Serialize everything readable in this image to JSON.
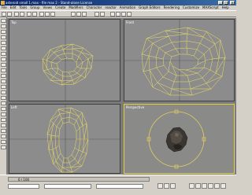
{
  "window": {
    "title": "asteroid small 1.max - file max 2 - Stand-alone License"
  },
  "menu": [
    "File",
    "Edit",
    "Tools",
    "Group",
    "Views",
    "Create",
    "Modifiers",
    "Character",
    "reactor",
    "Animation",
    "Graph Editors",
    "Rendering",
    "Customize",
    "MAXScript",
    "Help"
  ],
  "viewports": {
    "top": "Top",
    "front": "Front",
    "left": "Left",
    "perspective": "Perspective"
  },
  "timeline": {
    "frame_counter": "0 / 100"
  },
  "colors": {
    "wireframe": "#f0e060",
    "active_border": "#e0d040",
    "viewport_bg": "#8c8c8c",
    "gizmo": "#e8d060"
  }
}
